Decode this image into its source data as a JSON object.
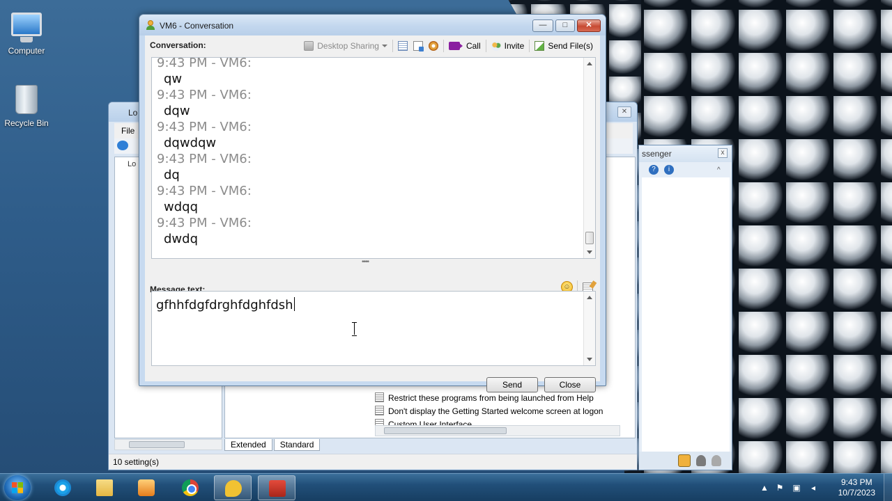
{
  "desktop": {
    "icons": [
      {
        "label": "Computer",
        "icon": "computer-icon"
      },
      {
        "label": "Recycle Bin",
        "icon": "recycle-bin-icon"
      }
    ]
  },
  "background_window": {
    "title_fragment": "Lo",
    "menu_file": "File",
    "tree_root_fragment": "Lo",
    "settings": [
      "Restrict these programs from being launched from Help",
      "Don't display the Getting Started welcome screen at logon",
      "Custom User Interface"
    ],
    "tabs": [
      "Extended",
      "Standard"
    ],
    "status": "10 setting(s)"
  },
  "messenger_window": {
    "title_fragment": "ssenger",
    "close_label": "x"
  },
  "conversation_window": {
    "title": "VM6 - Conversation",
    "conversation_label": "Conversation:",
    "toolbar": {
      "desktop_sharing": "Desktop Sharing",
      "call": "Call",
      "invite": "Invite",
      "send_files": "Send File(s)"
    },
    "messages": [
      {
        "header": "9:43 PM - VM6:",
        "text": "qw"
      },
      {
        "header": "9:43 PM - VM6:",
        "text": "dqw"
      },
      {
        "header": "9:43 PM - VM6:",
        "text": "dqwdqw"
      },
      {
        "header": "9:43 PM - VM6:",
        "text": "dq"
      },
      {
        "header": "9:43 PM - VM6:",
        "text": "wdqq"
      },
      {
        "header": "9:43 PM - VM6:",
        "text": "dwdq"
      }
    ],
    "message_text_label": "Message text:",
    "message_input_value": "gfhhfdgfdrghfdghfdsh",
    "send_label": "Send",
    "close_label": "Close",
    "window_buttons": {
      "minimize": "—",
      "maximize": "□",
      "close": "✕"
    }
  },
  "taskbar": {
    "apps": [
      {
        "name": "internet-explorer",
        "active": false
      },
      {
        "name": "file-explorer",
        "active": false
      },
      {
        "name": "media-player",
        "active": false
      },
      {
        "name": "chrome",
        "active": false
      },
      {
        "name": "messenger",
        "active": true
      },
      {
        "name": "toolbox",
        "active": true
      }
    ],
    "clock_time": "9:43 PM",
    "clock_date": "10/7/2023"
  }
}
